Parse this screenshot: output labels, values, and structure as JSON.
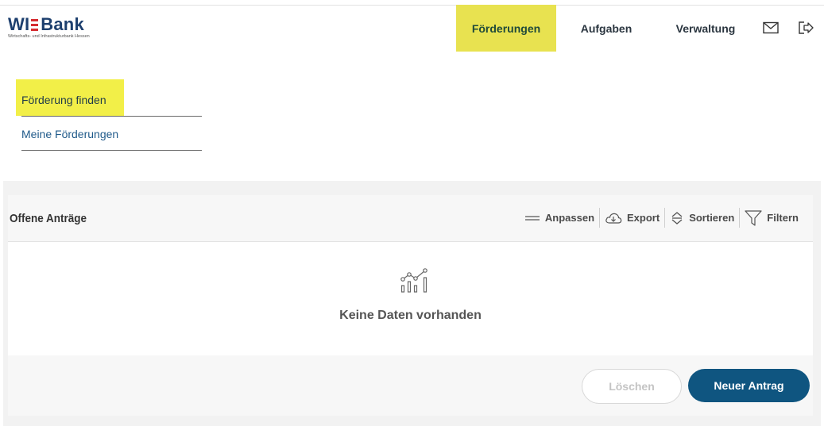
{
  "logo": {
    "name": "WI Bank",
    "part1": "WI",
    "part2": "Bank",
    "subtitle": "Wirtschafts- und Infrastrukturbank Hessen",
    "bar_color": "#d52b30"
  },
  "nav": {
    "items": [
      {
        "label": "Förderungen",
        "active": true
      },
      {
        "label": "Aufgaben",
        "active": false
      },
      {
        "label": "Verwaltung",
        "active": false
      }
    ],
    "icons": [
      "mail-icon",
      "logout-icon"
    ]
  },
  "subnav": {
    "items": [
      {
        "label": "Förderung finden",
        "highlighted": true
      },
      {
        "label": "Meine Förderungen",
        "highlighted": false
      }
    ]
  },
  "panel": {
    "title": "Offene Anträge",
    "toolbar": [
      {
        "label": "Anpassen",
        "icon": "adjust-lines-icon"
      },
      {
        "label": "Export",
        "icon": "cloud-download-icon"
      },
      {
        "label": "Sortieren",
        "icon": "sort-icon"
      },
      {
        "label": "Filtern",
        "icon": "filter-icon"
      }
    ],
    "empty_icon": "chart-empty-icon",
    "empty_text": "Keine Daten vorhanden",
    "buttons": {
      "delete_label": "Löschen",
      "new_label": "Neuer Antrag"
    }
  },
  "colors": {
    "nav_active_bg": "#e8e250",
    "highlight_bg": "#f2ef48",
    "primary_button": "#0f5580",
    "link": "#1f5a8a"
  }
}
